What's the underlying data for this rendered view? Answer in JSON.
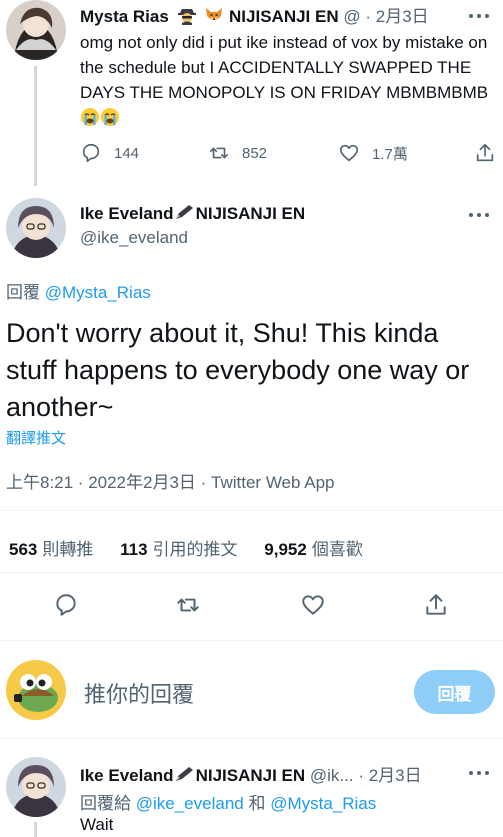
{
  "parent_tweet": {
    "display_name": "Mysta Rias",
    "affiliation": "NIJISANJI EN",
    "handle": "@",
    "date": "· 2月3日",
    "text": "omg not only did i put ike instead of vox by mistake on the schedule but I ACCIDENTALLY SWAPPED THE DAYS THE MONOPOLY IS ON FRIDAY MBMBMBMB",
    "reply_count": "144",
    "retweet_count": "852",
    "like_count": "1.7萬"
  },
  "main_tweet": {
    "display_name": "Ike Eveland",
    "affiliation": "NIJISANJI EN",
    "handle": "@ike_eveland",
    "reply_prefix": "回覆",
    "reply_to": "@Mysta_Rias",
    "text": "Don't worry about it, Shu! This kinda stuff happens to everybody one way or another~",
    "translate_label": "翻譯推文",
    "timestamp": "上午8:21 · 2022年2月3日 · Twitter Web App",
    "stats": {
      "retweets_num": "563",
      "retweets_label": "則轉推",
      "quotes_num": "113",
      "quotes_label": "引用的推文",
      "likes_num": "9,952",
      "likes_label": "個喜歡"
    }
  },
  "composer": {
    "placeholder": "推你的回覆",
    "reply_button": "回覆"
  },
  "next_reply": {
    "display_name": "Ike Eveland",
    "affiliation": "NIJISANJI EN",
    "handle": "@ik...",
    "date": "· 2月3日",
    "reply_prefix": "回覆給",
    "reply_to_1": "@ike_eveland",
    "reply_joiner": "和",
    "reply_to_2": "@Mysta_Rias",
    "text": "Wait"
  },
  "colors": {
    "accent": "#1d9bf0",
    "muted": "#536471",
    "reply_button_bg": "#8ecdf8"
  },
  "icons": [
    "reply-icon",
    "retweet-icon",
    "like-icon",
    "share-icon",
    "more-icon",
    "pen-icon",
    "spy-emoji",
    "fox-emoji",
    "crying-emoji"
  ]
}
